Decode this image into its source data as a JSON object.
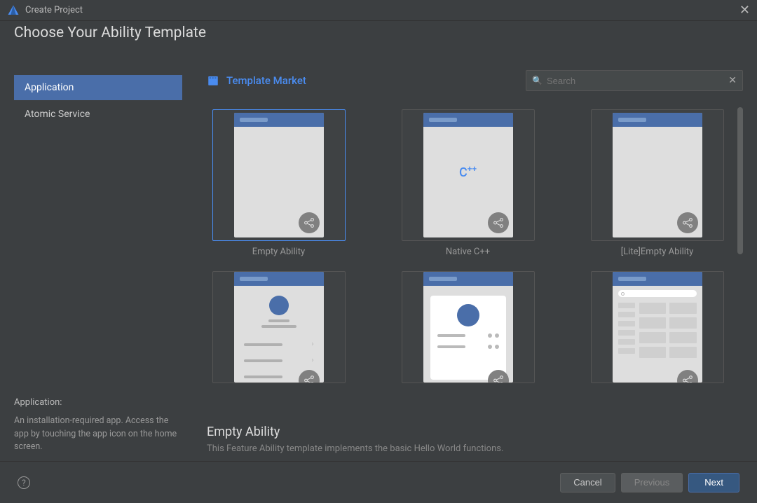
{
  "window": {
    "title": "Create Project"
  },
  "heading": "Choose Your Ability Template",
  "sidebar": {
    "items": [
      {
        "label": "Application",
        "active": true
      },
      {
        "label": "Atomic Service",
        "active": false
      }
    ],
    "info": {
      "title": "Application:",
      "desc": "An installation-required app. Access the app by touching the app icon on the home screen."
    }
  },
  "main": {
    "market_label": "Template Market",
    "search": {
      "placeholder": "Search",
      "value": ""
    },
    "templates": [
      {
        "label": "Empty Ability",
        "selected": true,
        "kind": "empty"
      },
      {
        "label": "Native C++",
        "selected": false,
        "kind": "cpp"
      },
      {
        "label": "[Lite]Empty Ability",
        "selected": false,
        "kind": "empty"
      },
      {
        "label": "",
        "selected": false,
        "kind": "about"
      },
      {
        "label": "",
        "selected": false,
        "kind": "card"
      },
      {
        "label": "",
        "selected": false,
        "kind": "dashboard"
      }
    ],
    "detail": {
      "title": "Empty Ability",
      "desc": "This Feature Ability template implements the basic Hello World functions."
    }
  },
  "footer": {
    "cancel": "Cancel",
    "previous": "Previous",
    "next": "Next"
  },
  "colors": {
    "accent": "#4a6ea9",
    "link": "#4a8cf0"
  }
}
